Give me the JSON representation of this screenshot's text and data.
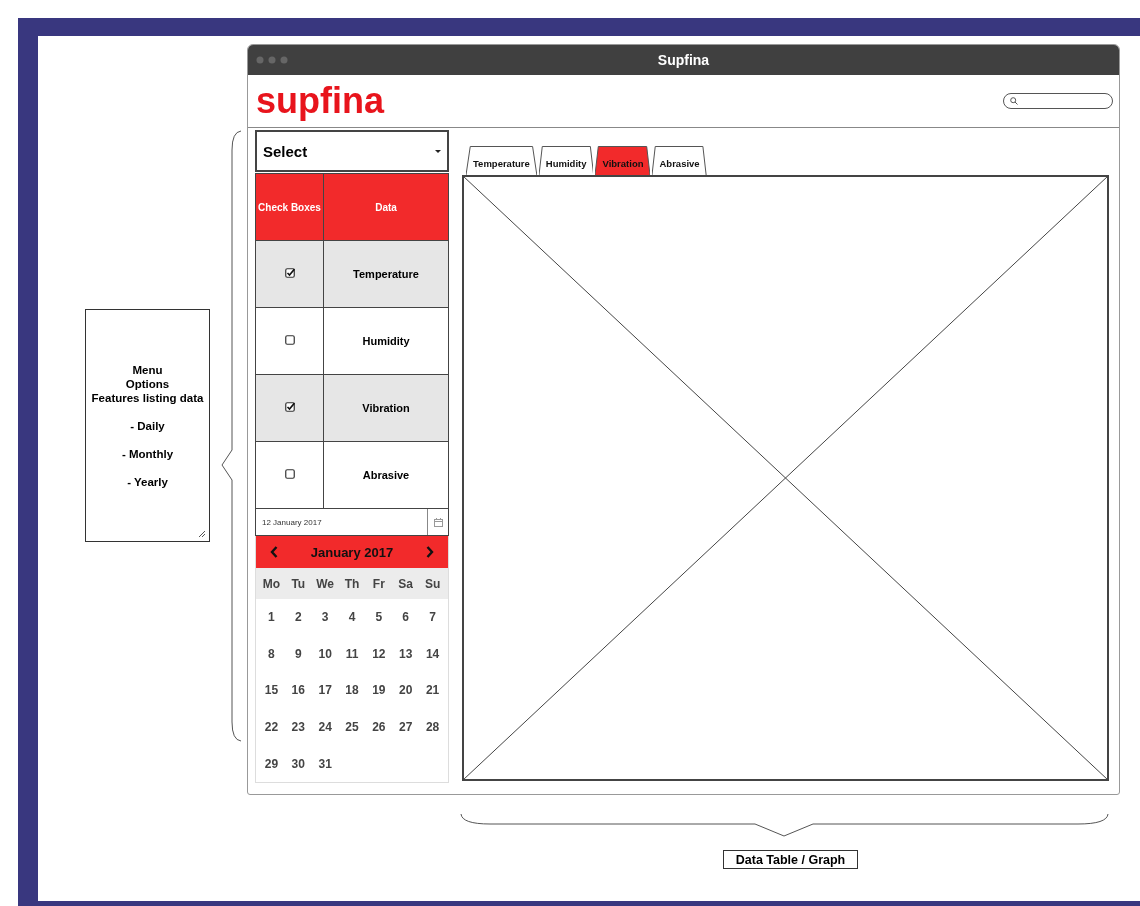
{
  "window": {
    "title": "Supfina",
    "logo": "supfina"
  },
  "select": {
    "value": "Select"
  },
  "table": {
    "columns": [
      "Check Boxes",
      "Data"
    ],
    "rows": [
      {
        "label": "Temperature",
        "checked": true
      },
      {
        "label": "Humidity",
        "checked": false
      },
      {
        "label": "Vibration",
        "checked": true
      },
      {
        "label": "Abrasive",
        "checked": false
      }
    ]
  },
  "date_field": {
    "value": "12 January 2017"
  },
  "calendar": {
    "month": "January 2017",
    "weekdays": [
      "Mo",
      "Tu",
      "We",
      "Th",
      "Fr",
      "Sa",
      "Su"
    ],
    "days": [
      "1",
      "2",
      "3",
      "4",
      "5",
      "6",
      "7",
      "8",
      "9",
      "10",
      "11",
      "12",
      "13",
      "14",
      "15",
      "16",
      "17",
      "18",
      "19",
      "20",
      "21",
      "22",
      "23",
      "24",
      "25",
      "26",
      "27",
      "28",
      "29",
      "30",
      "31"
    ]
  },
  "tabs": [
    {
      "label": "Temperature",
      "selected": false
    },
    {
      "label": "Humidity",
      "selected": false
    },
    {
      "label": "Vibration",
      "selected": true
    },
    {
      "label": "Abrasive",
      "selected": false
    }
  ],
  "note": {
    "lines": [
      "Menu",
      "Options",
      "Features listing data",
      "- Daily",
      "- Monthly",
      "- Yearly"
    ]
  },
  "caption": "Data Table / Graph"
}
